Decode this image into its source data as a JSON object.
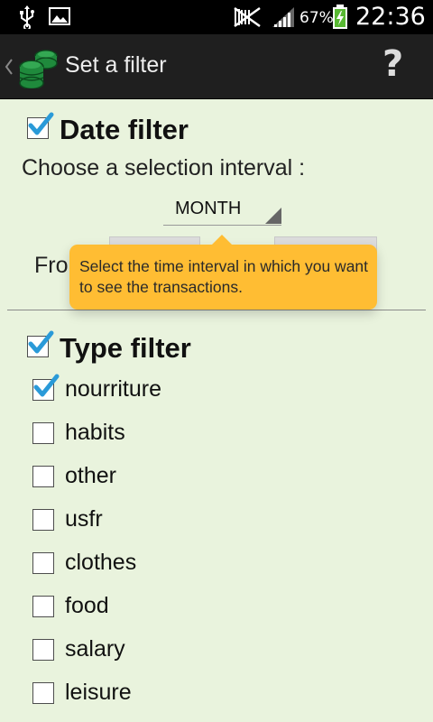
{
  "status_bar": {
    "icons": [
      "usb-icon",
      "image-icon",
      "no-sound-icon",
      "signal-icon",
      "battery-charging-icon"
    ],
    "battery_percent": "67%",
    "time": "22:36"
  },
  "action_bar": {
    "title": "Set a filter",
    "help_label": "?",
    "up_icon": "chevron-left-icon",
    "app_icon": "coins-stack-icon"
  },
  "date_filter": {
    "checked": true,
    "title": "Date filter",
    "prompt": "Choose a selection interval :",
    "interval_value": "MONTH",
    "from_label_visible": "Fro"
  },
  "tooltip": {
    "text": "Select the time interval in which you want to see the transactions."
  },
  "type_filter": {
    "checked": true,
    "title": "Type filter",
    "items": [
      {
        "label": "nourriture",
        "checked": true
      },
      {
        "label": "habits",
        "checked": false
      },
      {
        "label": "other",
        "checked": false
      },
      {
        "label": "usfr",
        "checked": false
      },
      {
        "label": "clothes",
        "checked": false
      },
      {
        "label": "food",
        "checked": false
      },
      {
        "label": "salary",
        "checked": false
      },
      {
        "label": "leisure",
        "checked": false
      }
    ]
  },
  "colors": {
    "background": "#e9f3dd",
    "tooltip": "#ffbd33",
    "checkmark": "#2a9ad8",
    "action_bar": "#1f1f1f"
  }
}
